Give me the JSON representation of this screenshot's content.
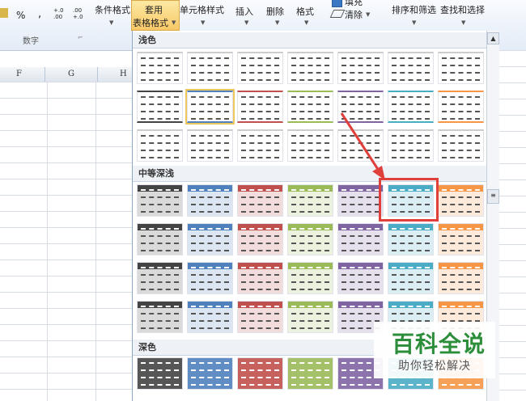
{
  "ribbon": {
    "number_buttons": {
      "percent": "%",
      "comma": ",",
      "inc_decimal": "+.0 .00",
      "dec_decimal": ".00 +.0"
    },
    "number_group_label": "数字",
    "conditional_format": "条件格式",
    "format_as_table_line1": "套用",
    "format_as_table_line2": "表格格式",
    "cell_styles": "单元格样式",
    "insert": "插入",
    "delete": "删除",
    "format": "格式",
    "fill_partial": "填充",
    "clear": "清除",
    "sort_filter": "排序和筛选",
    "find_select": "查找和选择"
  },
  "columns": [
    "F",
    "G",
    "H"
  ],
  "gallery": {
    "sections": [
      {
        "label": "浅色"
      },
      {
        "label": "中等深浅"
      },
      {
        "label": "深色"
      }
    ],
    "colors": [
      "#444444",
      "#4f81bd",
      "#c0504d",
      "#9bbb59",
      "#8064a2",
      "#4bacc6",
      "#f79646"
    ]
  },
  "watermark": {
    "title": "百科全说",
    "subtitle": "助你轻松解决"
  },
  "colors": {
    "highlight": "#f8c867",
    "red_annotation": "#e0403c",
    "watermark_green": "#2c8e3a"
  }
}
